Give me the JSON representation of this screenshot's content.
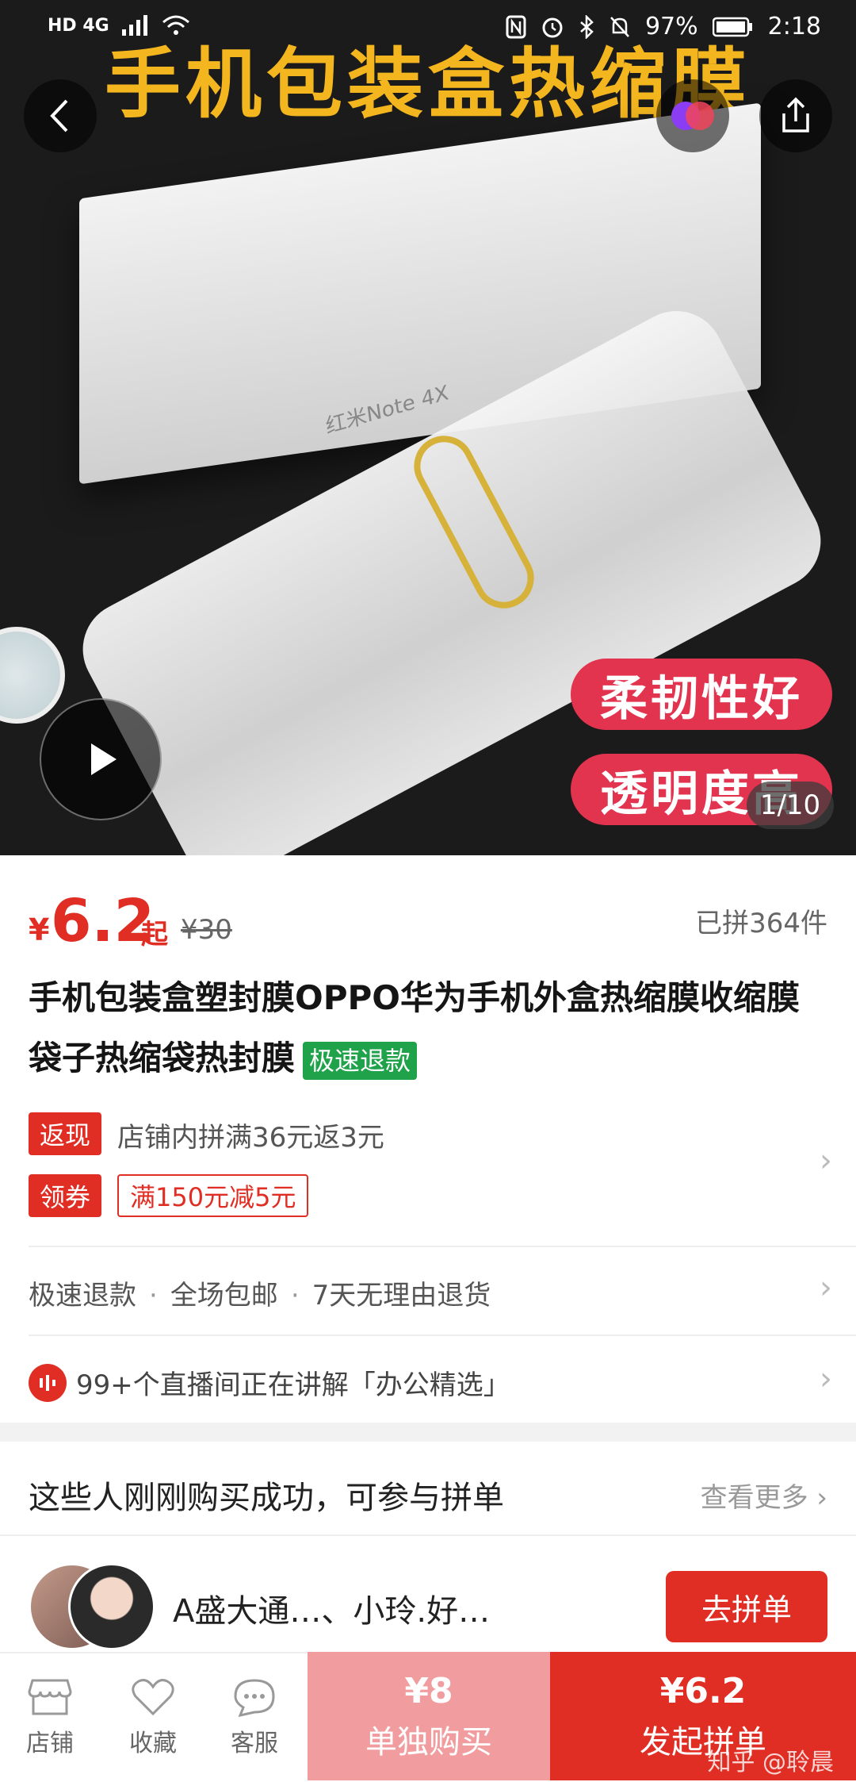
{
  "status_bar": {
    "left": "HD 4G",
    "battery": "97%",
    "time": "2:18"
  },
  "hero": {
    "banner": "手机包装盒热缩膜",
    "box_label": "红米Note 4X",
    "pill1": "柔韧性好",
    "pill2": "透明度高",
    "counter": "1/10"
  },
  "product": {
    "currency": "¥",
    "price": "6.2",
    "price_suffix": "起",
    "original_price": "¥30",
    "sold": "已拼364件",
    "title": "手机包装盒塑封膜OPPO华为手机外盒热缩膜收缩膜袋子热缩袋热封膜",
    "fast_refund_badge": "极速退款",
    "promo_tag1": "返现",
    "promo_text1": "店铺内拼满36元返3元",
    "promo_tag2": "领券",
    "coupon_text": "满150元减5元",
    "services": [
      "极速退款",
      "全场包邮",
      "7天无理由退货"
    ],
    "live_text": "99+个直播间正在讲解「办公精选」"
  },
  "group": {
    "title": "这些人刚刚购买成功，可参与拼单",
    "see_more": "查看更多",
    "names": "A盛大通…、小玲.好…",
    "join_button": "去拼单"
  },
  "bottom_bar": {
    "shop": "店铺",
    "favorite": "收藏",
    "service": "客服",
    "single_price": "¥8",
    "single_label": "单独购买",
    "group_price": "¥6.2",
    "group_label": "发起拼单",
    "watermark": "知乎 @聆晨"
  }
}
